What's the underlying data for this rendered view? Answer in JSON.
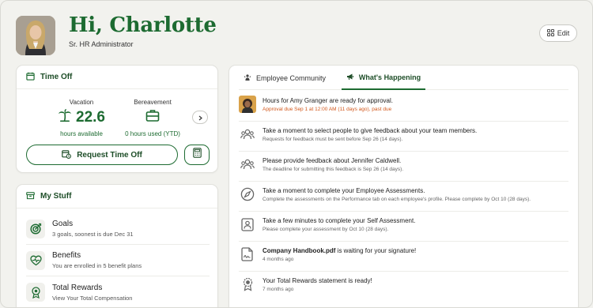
{
  "header": {
    "greeting": "Hi, Charlotte",
    "role": "Sr. HR Administrator",
    "edit_label": "Edit"
  },
  "time_off": {
    "title": "Time Off",
    "vacation": {
      "label": "Vacation",
      "value": "22.6",
      "sub": "hours available"
    },
    "bereavement": {
      "label": "Bereavement",
      "sub": "0 hours used (YTD)"
    },
    "request_label": "Request Time Off"
  },
  "my_stuff": {
    "title": "My Stuff",
    "items": [
      {
        "title": "Goals",
        "sub": "3 goals, soonest is due Dec 31",
        "icon": "target-icon"
      },
      {
        "title": "Benefits",
        "sub": "You are enrolled in 5 benefit plans",
        "icon": "heart-pulse-icon"
      },
      {
        "title": "Total Rewards",
        "sub": "View Your Total Compensation",
        "icon": "medal-icon"
      }
    ]
  },
  "feed": {
    "tabs": [
      {
        "label": "Employee Community",
        "icon": "community-icon"
      },
      {
        "label": "What's Happening",
        "icon": "megaphone-icon",
        "active": true
      }
    ],
    "items": [
      {
        "title": "Hours for Amy Granger are ready for approval.",
        "sub": "Approval due Sep 1 at 12:00 AM (11 days ago), past due",
        "icon": "avatar"
      },
      {
        "title": "Take a moment to select people to give feedback about your team members.",
        "sub": "Requests for feedback must be sent before Sep 26 (14 days).",
        "icon": "people-icon"
      },
      {
        "title": "Please provide feedback about Jennifer Caldwell.",
        "sub": "The deadline for submitting this feedback is Sep 26 (14 days).",
        "icon": "people-icon"
      },
      {
        "title": "Take a moment to complete your Employee Assessments.",
        "sub": "Complete the assessments on the Performance tab on each employee's profile. Please complete by Oct 10 (28 days).",
        "icon": "compass-icon"
      },
      {
        "title": "Take a few minutes to complete your Self Assessment.",
        "sub": "Please complete your assessment by Oct 10 (28 days).",
        "icon": "person-card-icon"
      },
      {
        "title_bold": "Company Handbook.pdf",
        "title_rest": " is waiting for your signature!",
        "sub": "4 months ago",
        "icon": "signature-icon"
      },
      {
        "title": "Your Total Rewards statement is ready!",
        "sub": "7 months ago",
        "icon": "ribbon-icon"
      }
    ]
  },
  "colors": {
    "brand": "#1d6b31",
    "alert": "#d2581c",
    "background": "#f2f2ee"
  }
}
